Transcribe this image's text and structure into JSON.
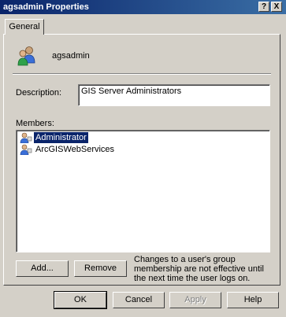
{
  "window": {
    "title": "agsadmin Properties",
    "help_btn": "?",
    "close_btn": "X"
  },
  "tabs": [
    {
      "label": "General"
    }
  ],
  "group": {
    "name": "agsadmin"
  },
  "description": {
    "label": "Description:",
    "value": "GIS Server Administrators"
  },
  "members": {
    "label": "Members:",
    "items": [
      {
        "name": "Administrator",
        "selected": true
      },
      {
        "name": "ArcGISWebServices",
        "selected": false
      }
    ]
  },
  "actions": {
    "add": "Add...",
    "remove": "Remove"
  },
  "note": "Changes to a user's group membership are not effective until the next time the user logs on.",
  "footer": {
    "ok": "OK",
    "cancel": "Cancel",
    "apply": "Apply",
    "help": "Help"
  }
}
